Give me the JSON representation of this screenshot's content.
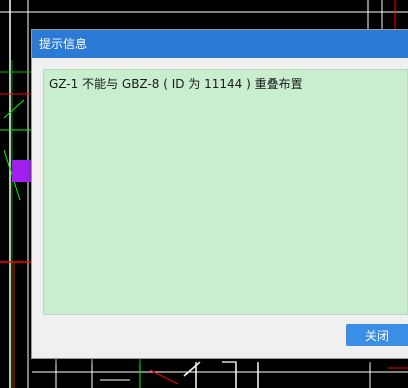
{
  "dialog": {
    "title": "提示信息",
    "message": "GZ-1 不能与 GBZ-8 ( ID 为 11144 ) 重叠布置",
    "close_label": "关闭",
    "accent_color": "#2b7bd6",
    "message_bg_color": "#c8edcf"
  },
  "background": {
    "application": "CAD drawing canvas",
    "line_colors": [
      "#ffffff",
      "#00ff00",
      "#ff0000",
      "#a020f0"
    ]
  }
}
